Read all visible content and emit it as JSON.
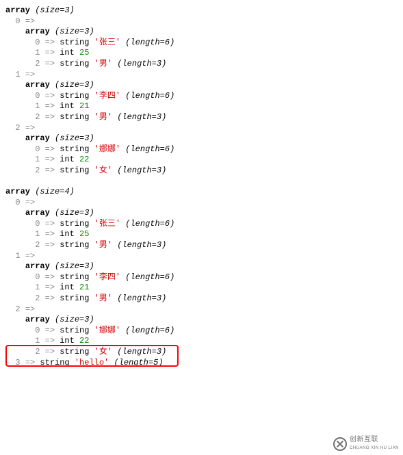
{
  "dump1": {
    "size": 3,
    "items": [
      {
        "key": 0,
        "type": "array",
        "size": 3,
        "children": [
          {
            "key": 0,
            "type": "string",
            "value": "张三",
            "length": 6
          },
          {
            "key": 1,
            "type": "int",
            "value": 25
          },
          {
            "key": 2,
            "type": "string",
            "value": "男",
            "length": 3
          }
        ]
      },
      {
        "key": 1,
        "type": "array",
        "size": 3,
        "children": [
          {
            "key": 0,
            "type": "string",
            "value": "李四",
            "length": 6
          },
          {
            "key": 1,
            "type": "int",
            "value": 21
          },
          {
            "key": 2,
            "type": "string",
            "value": "男",
            "length": 3
          }
        ]
      },
      {
        "key": 2,
        "type": "array",
        "size": 3,
        "children": [
          {
            "key": 0,
            "type": "string",
            "value": "娜娜",
            "length": 6
          },
          {
            "key": 1,
            "type": "int",
            "value": 22
          },
          {
            "key": 2,
            "type": "string",
            "value": "女",
            "length": 3
          }
        ]
      }
    ]
  },
  "dump2": {
    "size": 4,
    "items": [
      {
        "key": 0,
        "type": "array",
        "size": 3,
        "children": [
          {
            "key": 0,
            "type": "string",
            "value": "张三",
            "length": 6
          },
          {
            "key": 1,
            "type": "int",
            "value": 25
          },
          {
            "key": 2,
            "type": "string",
            "value": "男",
            "length": 3
          }
        ]
      },
      {
        "key": 1,
        "type": "array",
        "size": 3,
        "children": [
          {
            "key": 0,
            "type": "string",
            "value": "李四",
            "length": 6
          },
          {
            "key": 1,
            "type": "int",
            "value": 21
          },
          {
            "key": 2,
            "type": "string",
            "value": "男",
            "length": 3
          }
        ]
      },
      {
        "key": 2,
        "type": "array",
        "size": 3,
        "children": [
          {
            "key": 0,
            "type": "string",
            "value": "娜娜",
            "length": 6
          },
          {
            "key": 1,
            "type": "int",
            "value": 22
          },
          {
            "key": 2,
            "type": "string",
            "value": "女",
            "length": 3
          }
        ]
      },
      {
        "key": 3,
        "type": "string",
        "value": "hello",
        "length": 5
      }
    ]
  },
  "labels": {
    "array": "array",
    "string": "string",
    "int": "int",
    "size": "size",
    "length": "length",
    "arrow": "=>"
  },
  "watermark": {
    "line1": "创新互联",
    "line2": "CHUANG XIN HU LIAN"
  }
}
